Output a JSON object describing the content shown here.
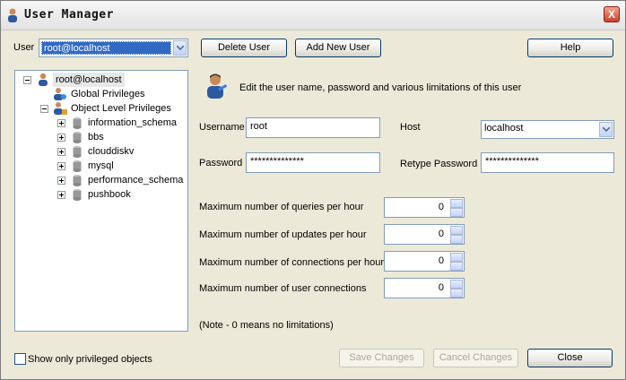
{
  "window": {
    "title": "User Manager",
    "close_label": "X"
  },
  "user_select": {
    "label": "User",
    "value": "root@localhost"
  },
  "toolbar": {
    "delete_label": "Delete User",
    "add_label": "Add New User",
    "help_label": "Help"
  },
  "tree": {
    "root": "root@localhost",
    "global": "Global Privileges",
    "object_level": "Object Level Privileges",
    "databases": [
      "information_schema",
      "bbs",
      "clouddiskv",
      "mysql",
      "performance_schema",
      "pushbook"
    ]
  },
  "description": "Edit the user name, password and various limitations of this user",
  "form": {
    "username_label": "Username",
    "username_value": "root",
    "host_label": "Host",
    "host_value": "localhost",
    "password_label": "Password",
    "password_value": "**************",
    "retype_label": "Retype Password",
    "retype_value": "**************"
  },
  "limits": [
    {
      "label": "Maximum number of queries per hour",
      "value": "0"
    },
    {
      "label": "Maximum number of updates per hour",
      "value": "0"
    },
    {
      "label": "Maximum number of connections per hour",
      "value": "0"
    },
    {
      "label": "Maximum number of user connections",
      "value": "0"
    }
  ],
  "note": "(Note - 0 means no limitations)",
  "footer": {
    "show_privileged_label": "Show only privileged objects",
    "save_label": "Save Changes",
    "cancel_label": "Cancel Changes",
    "close_label": "Close"
  },
  "colors": {
    "selection": "#316ac5",
    "window_bg": "#ece9d8",
    "border": "#7f9db9"
  }
}
